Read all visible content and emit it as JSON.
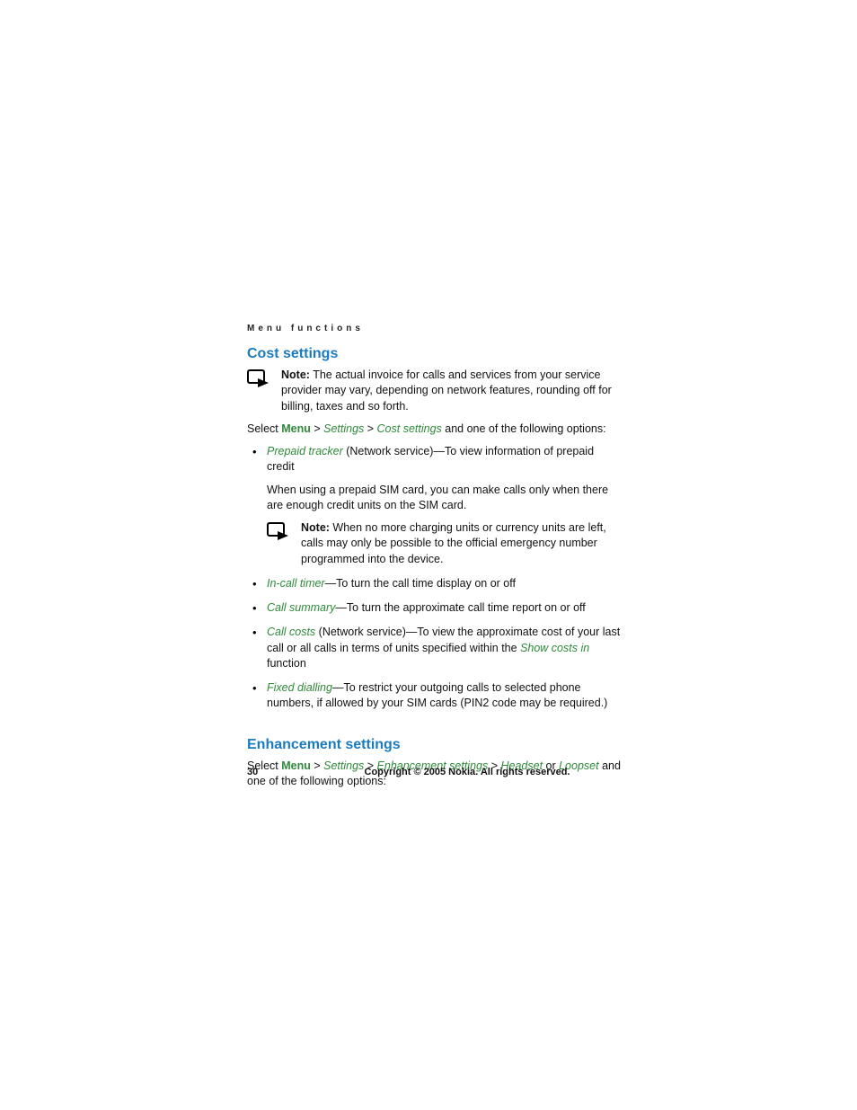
{
  "header": {
    "running": "Menu functions"
  },
  "section1": {
    "title": "Cost settings",
    "note1": {
      "label": "Note:",
      "text": " The actual invoice for calls and services from your service provider may vary, depending on network features, rounding off for billing, taxes and so forth."
    },
    "selectLine": {
      "pre": "Select ",
      "nav1": "Menu",
      "sep": " > ",
      "nav2": "Settings",
      "nav3": "Cost settings",
      "post": " and one of the following options:"
    },
    "bullet1": {
      "term": "Prepaid tracker",
      "rest": " (Network service)—To view information of prepaid credit",
      "sub": "When using a prepaid SIM card, you can make calls only when there are enough credit units on the SIM card.",
      "note": {
        "label": "Note:",
        "text": " When no more charging units or currency units are left, calls may only be possible to the official emergency number programmed into the device."
      }
    },
    "bullet2": {
      "term": "In-call timer",
      "rest": "—To turn the call time display on or off"
    },
    "bullet3": {
      "term": "Call summary",
      "rest": "—To turn the approximate call time report on or off"
    },
    "bullet4": {
      "term": "Call costs",
      "restA": " (Network service)—To view the approximate cost of your last call or all calls in terms of units specified within the ",
      "link": "Show costs in",
      "restB": " function"
    },
    "bullet5": {
      "term": "Fixed dialling",
      "rest": "—To restrict your outgoing calls to selected phone numbers, if allowed by your SIM cards (PIN2 code may be required.)"
    }
  },
  "section2": {
    "title": "Enhancement settings",
    "selectLine": {
      "pre": "Select ",
      "nav1": "Menu",
      "sep": " > ",
      "nav2": "Settings",
      "nav3": "Enhancement settings",
      "nav4": "Headset",
      "or": " or ",
      "nav5": "Loopset",
      "post": " and one of the following options:"
    }
  },
  "footer": {
    "page": "30",
    "copyright": "Copyright © 2005 Nokia. All rights reserved."
  }
}
